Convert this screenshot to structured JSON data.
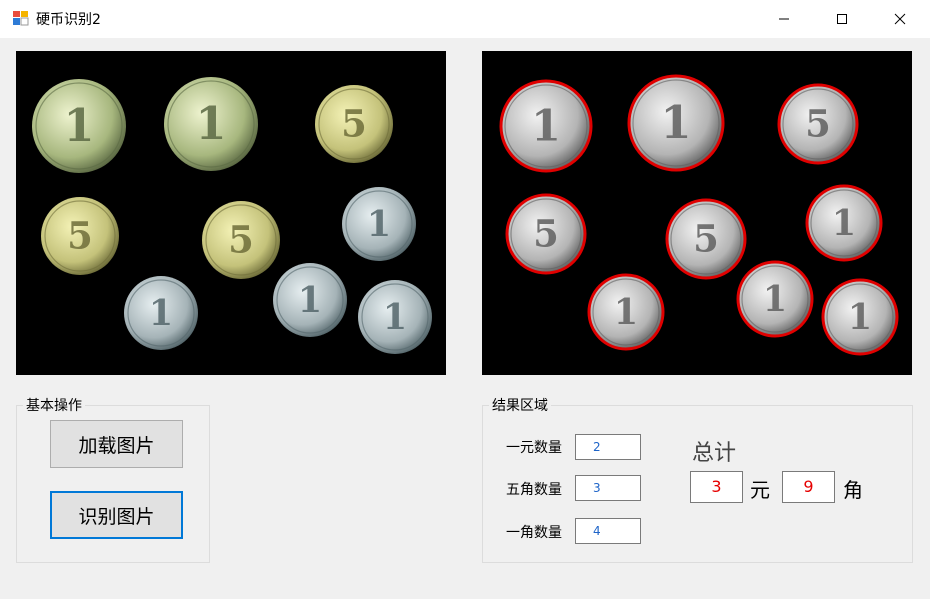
{
  "window": {
    "title": "硬币识别2"
  },
  "images": {
    "original": {
      "coins": [
        "1",
        "1",
        "5",
        "5",
        "5",
        "1",
        "1",
        "1",
        "1"
      ]
    },
    "result": {
      "detected_count": 9,
      "highlight_color": "#e00000"
    }
  },
  "ops_group": {
    "label": "基本操作",
    "load_button": "加载图片",
    "recognize_button": "识别图片"
  },
  "result_group": {
    "label": "结果区域",
    "one_yuan_label": "一元数量",
    "one_yuan_value": "2",
    "five_jiao_label": "五角数量",
    "five_jiao_value": "3",
    "one_jiao_label": "一角数量",
    "one_jiao_value": "4",
    "total_label": "总计",
    "total_yuan": "3",
    "yuan_unit": "元",
    "total_jiao": "9",
    "jiao_unit": "角"
  },
  "colors": {
    "accent": "#0078d7",
    "value_text": "#1e64c8",
    "total_text": "#e60000"
  }
}
